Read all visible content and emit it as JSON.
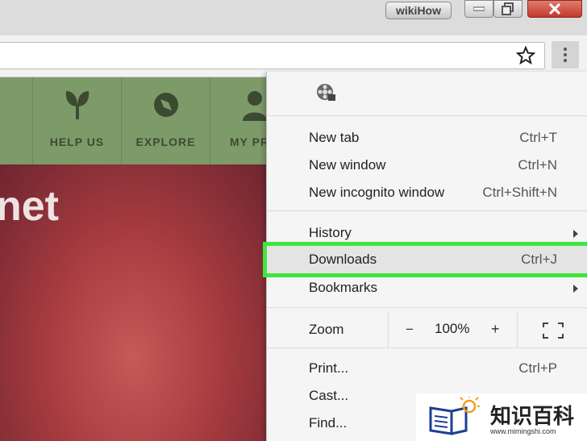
{
  "window": {
    "profile_label": "wikiHow"
  },
  "site_nav": {
    "items": [
      {
        "label": "HELP US",
        "icon": "sprout-icon"
      },
      {
        "label": "EXPLORE",
        "icon": "compass-icon"
      },
      {
        "label": "MY PRO",
        "icon": "person-icon"
      }
    ],
    "hero_text": "net"
  },
  "chrome_menu": {
    "items": [
      {
        "label": "New tab",
        "shortcut": "Ctrl+T"
      },
      {
        "label": "New window",
        "shortcut": "Ctrl+N"
      },
      {
        "label": "New incognito window",
        "shortcut": "Ctrl+Shift+N"
      },
      {
        "label": "History",
        "shortcut": ""
      },
      {
        "label": "Downloads",
        "shortcut": "Ctrl+J"
      },
      {
        "label": "Bookmarks",
        "shortcut": ""
      },
      {
        "label": "Print...",
        "shortcut": "Ctrl+P"
      },
      {
        "label": "Cast...",
        "shortcut": ""
      },
      {
        "label": "Find...",
        "shortcut": ""
      }
    ],
    "zoom": {
      "label": "Zoom",
      "minus": "−",
      "value": "100%",
      "plus": "+"
    }
  },
  "watermark": {
    "text": "知识百科",
    "url": "www.mimingshi.com"
  },
  "colors": {
    "highlight_border": "#3ee63e",
    "nav_green": "#7d9a69"
  }
}
